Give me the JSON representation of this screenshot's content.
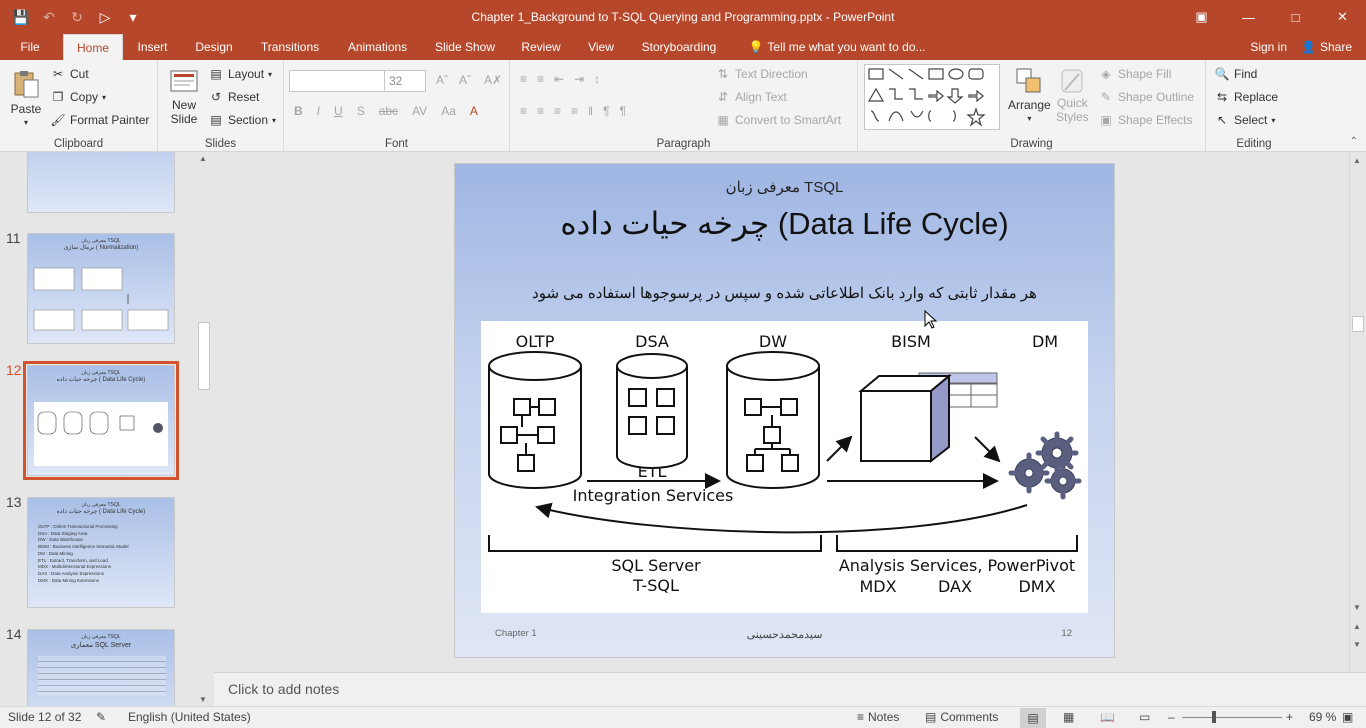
{
  "window": {
    "title": "Chapter 1_Background to T-SQL Querying and Programming.pptx - PowerPoint",
    "buttons": [
      "restore-icon",
      "minimize-icon",
      "maximize-icon",
      "close-icon"
    ]
  },
  "ribbon_tabs": [
    "File",
    "Home",
    "Insert",
    "Design",
    "Transitions",
    "Animations",
    "Slide Show",
    "Review",
    "View",
    "Storyboarding"
  ],
  "active_tab": "Home",
  "tell_me": "Tell me what you want to do...",
  "sign_in": "Sign in",
  "share": "Share",
  "clipboard": {
    "label": "Clipboard",
    "paste": "Paste",
    "cut": "Cut",
    "copy": "Copy",
    "format_painter": "Format Painter"
  },
  "slides_group": {
    "label": "Slides",
    "new_slide_1": "New",
    "new_slide_2": "Slide",
    "layout": "Layout",
    "reset": "Reset",
    "section": "Section"
  },
  "font_group": {
    "label": "Font",
    "font_name": "",
    "font_size": "32"
  },
  "paragraph_group": {
    "label": "Paragraph",
    "text_direction": "Text Direction",
    "align_text": "Align Text",
    "convert_smartart": "Convert to SmartArt"
  },
  "drawing_group": {
    "label": "Drawing",
    "arrange": "Arrange",
    "quick_styles_1": "Quick",
    "quick_styles_2": "Styles",
    "shape_fill": "Shape Fill",
    "shape_outline": "Shape Outline",
    "shape_effects": "Shape Effects"
  },
  "editing_group": {
    "label": "Editing",
    "find": "Find",
    "replace": "Replace",
    "select": "Select"
  },
  "thumbnails": [
    {
      "number": "",
      "title": "",
      "sub": ""
    },
    {
      "number": "11",
      "title": "نرمال سازی ( Normalization)",
      "sub": "معرفی زبان TSQL"
    },
    {
      "number": "12",
      "title": "چرخه حیات داده ( Data Life Cycle)",
      "sub": "معرفی زبان TSQL"
    },
    {
      "number": "13",
      "title": "چرخه حیات داده ( Data Life Cycle)",
      "sub": "معرفی زبان TSQL"
    },
    {
      "number": "14",
      "title": "معماری SQL Server",
      "sub": "معرفی زبان TSQL"
    }
  ],
  "thumb13_lines": [
    "OLTP : Online Transactional Processing",
    "DSA : Data Staging Area",
    "DW : Data Warehouse",
    "BISM : Business Intelligence Semantic Model",
    "DM : Data Mining",
    "ETL : Extract, Transform, and Load",
    "MDX : Multidimensional Expressions",
    "DAX : Data Analysis Expressions",
    "DMX : Data Mining Extensions"
  ],
  "slide": {
    "subtitle": "معرفی زبان TSQL",
    "title": "چرخه حیات داده (Data Life Cycle)",
    "body": "هر مقدار ثابتی که وارد بانک اطلاعاتی شده و سپس در پرسوجوها استفاده می شود",
    "footer_left": "Chapter 1",
    "footer_center": "سیدمحمدحسینی",
    "footer_right": "12"
  },
  "diagram": {
    "labels": {
      "oltp": "OLTP",
      "dsa": "DSA",
      "dw": "DW",
      "bism": "BISM",
      "dm": "DM",
      "etl": "ETL",
      "integration": "Integration Services",
      "sqlserver": "SQL Server",
      "tsql": "T-SQL",
      "analysis": "Analysis Services, PowerPivot",
      "mdx": "MDX",
      "dax": "DAX",
      "dmx": "DMX"
    }
  },
  "notes_placeholder": "Click to add notes",
  "status": {
    "slide_of": "Slide 12 of 32",
    "language": "English (United States)",
    "notes": "Notes",
    "comments": "Comments",
    "zoom": "69 %"
  },
  "colors": {
    "accent": "#b7472a",
    "selection": "#d35230",
    "slide_bg_top": "#9fb6e3"
  }
}
